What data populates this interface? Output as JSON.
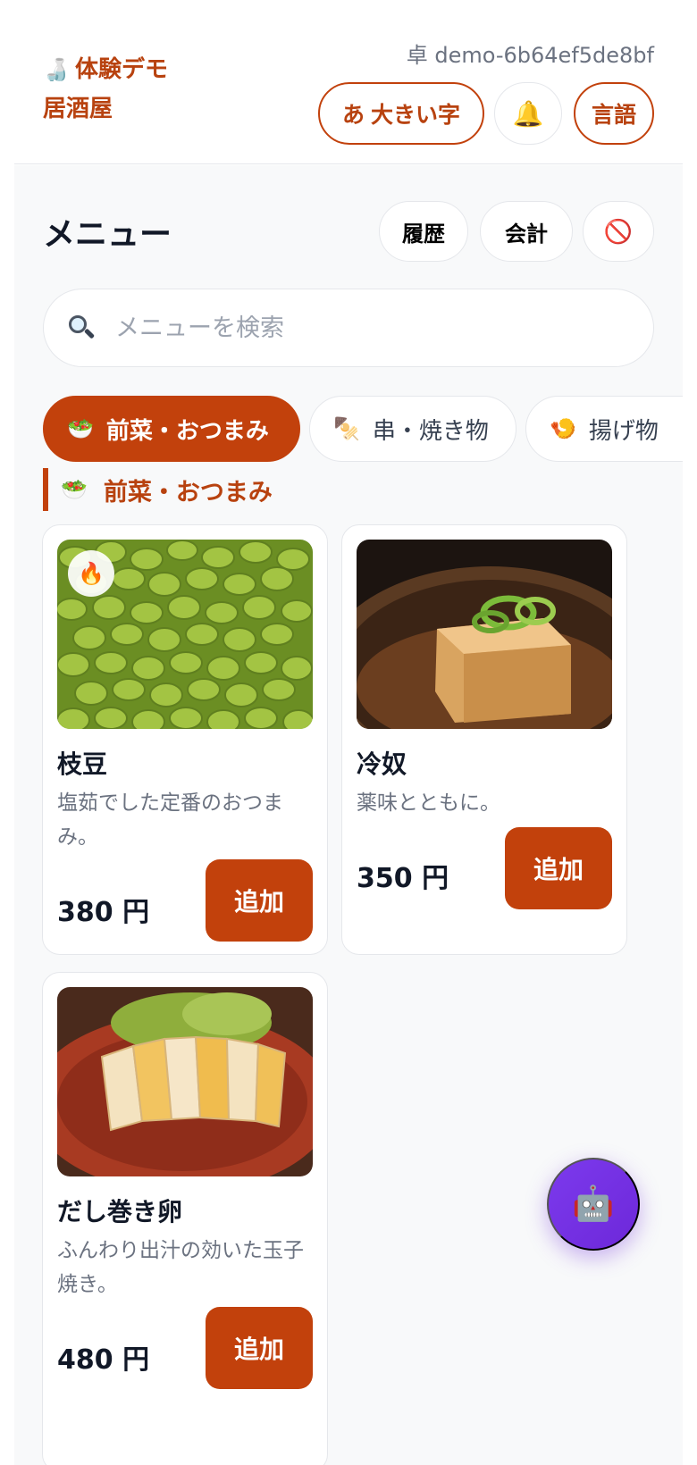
{
  "header": {
    "logo_icon": "sake-bottle-icon",
    "brand_line1": "体験デモ",
    "brand_line2": "居酒屋",
    "table_id": "卓 demo-6b64ef5de8bf",
    "large_text_label": "あ 大きい字",
    "bell_icon": "bell-icon",
    "language_label": "言語"
  },
  "menu": {
    "title": "メニュー",
    "history_label": "履歴",
    "bill_label": "会計",
    "stop_icon": "prohibited-icon"
  },
  "search": {
    "placeholder": "メニューを検索",
    "icon": "magnifier-icon"
  },
  "categories": [
    {
      "emoji": "🥗",
      "label": "前菜・おつまみ",
      "active": true
    },
    {
      "emoji": "🍢",
      "label": "串・焼き物",
      "active": false
    },
    {
      "emoji": "🍤",
      "label": "揚げ物",
      "active": false
    }
  ],
  "section": {
    "emoji": "🥗",
    "title": "前菜・おつまみ"
  },
  "items": [
    {
      "name": "枝豆",
      "description": "塩茹でした定番のおつまみ。",
      "price": "380 円",
      "add_label": "追加",
      "badge": "🔥",
      "badge_icon": "fire-icon"
    },
    {
      "name": "冷奴",
      "description": "薬味とともに。",
      "price": "350 円",
      "add_label": "追加"
    },
    {
      "name": "だし巻き卵",
      "description": "ふんわり出汁の効いた玉子焼き。",
      "price": "480 円",
      "add_label": "追加"
    }
  ],
  "assistant": {
    "icon": "robot-icon",
    "emoji": "🤖"
  },
  "colors": {
    "accent": "#c2410c",
    "background": "#f8f9fa",
    "assistant": "#7c3aed"
  }
}
